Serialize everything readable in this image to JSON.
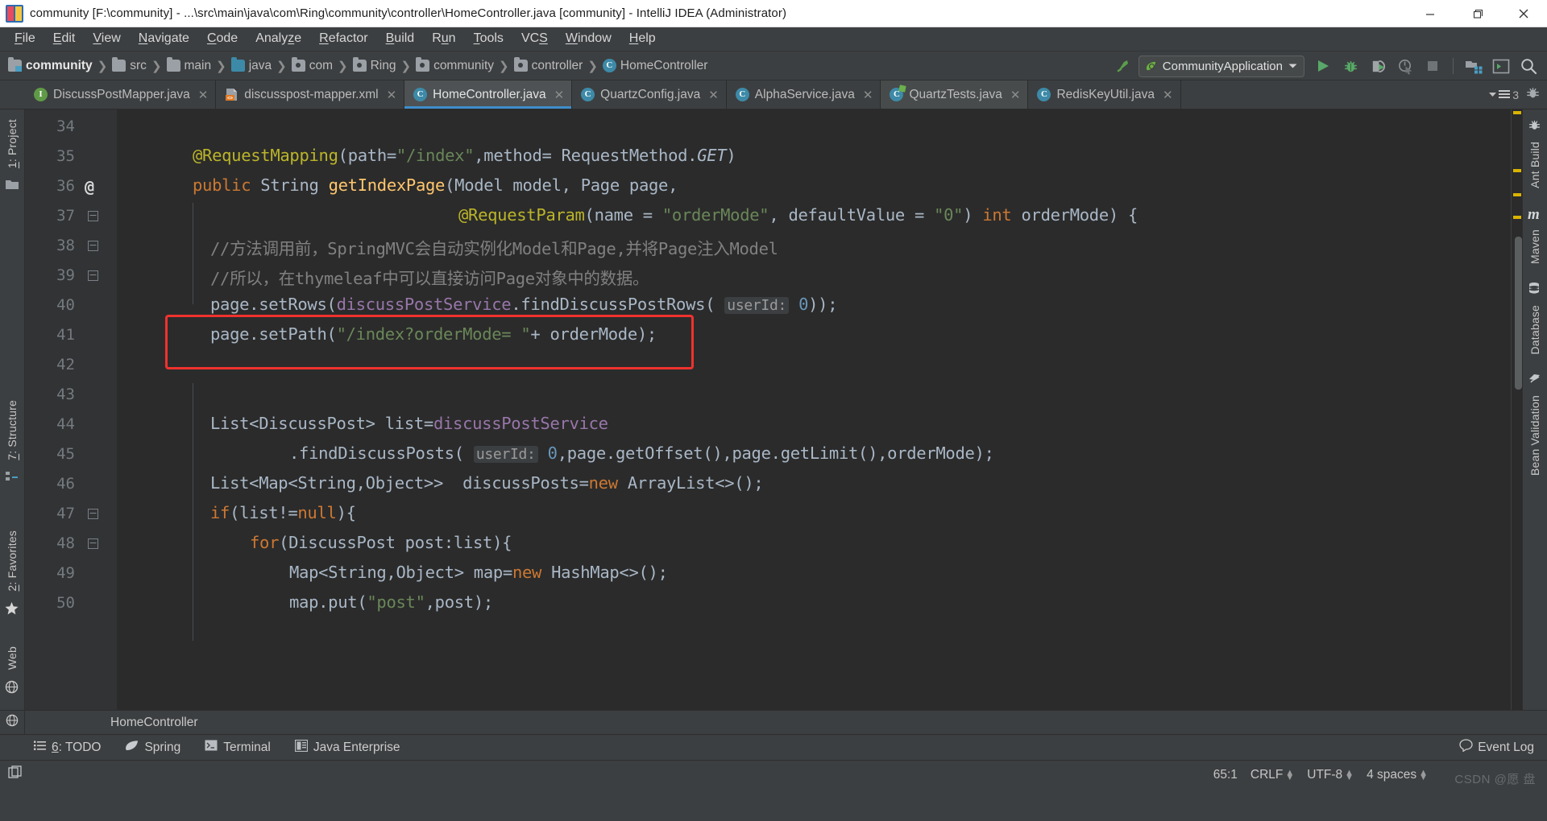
{
  "window": {
    "title": "community [F:\\community] - ...\\src\\main\\java\\com\\Ring\\community\\controller\\HomeController.java [community] - IntelliJ IDEA (Administrator)",
    "app_icon": "intellij-idea-icon",
    "minimize_label": "Minimize",
    "maximize_label": "Restore",
    "close_label": "Close"
  },
  "menubar": {
    "items": [
      {
        "label": "File",
        "mnemonic": "F"
      },
      {
        "label": "Edit",
        "mnemonic": "E"
      },
      {
        "label": "View",
        "mnemonic": "V"
      },
      {
        "label": "Navigate",
        "mnemonic": "N"
      },
      {
        "label": "Code",
        "mnemonic": "C"
      },
      {
        "label": "Analyze",
        "mnemonic": "z"
      },
      {
        "label": "Refactor",
        "mnemonic": "R"
      },
      {
        "label": "Build",
        "mnemonic": "B"
      },
      {
        "label": "Run",
        "mnemonic": "n"
      },
      {
        "label": "Tools",
        "mnemonic": "T"
      },
      {
        "label": "VCS",
        "mnemonic": "S"
      },
      {
        "label": "Window",
        "mnemonic": "W"
      },
      {
        "label": "Help",
        "mnemonic": "H"
      }
    ]
  },
  "breadcrumb": {
    "items": [
      {
        "label": "community",
        "icon": "project-folder-icon"
      },
      {
        "label": "src",
        "icon": "source-folder-icon"
      },
      {
        "label": "main",
        "icon": "folder-icon"
      },
      {
        "label": "java",
        "icon": "java-source-folder-icon"
      },
      {
        "label": "com",
        "icon": "package-icon"
      },
      {
        "label": "Ring",
        "icon": "package-icon"
      },
      {
        "label": "community",
        "icon": "package-icon"
      },
      {
        "label": "controller",
        "icon": "package-icon"
      },
      {
        "label": "HomeController",
        "icon": "java-class-icon"
      }
    ]
  },
  "toolbar": {
    "build_label": "Build Project",
    "run_config": "CommunityApplication",
    "run_config_icon": "spring-boot-icon",
    "buttons": [
      {
        "name": "run-button",
        "icon": "play-icon",
        "label": "Run"
      },
      {
        "name": "debug-button",
        "icon": "bug-icon",
        "label": "Debug"
      },
      {
        "name": "run-with-coverage-button",
        "icon": "coverage-icon",
        "label": "Run with Coverage"
      },
      {
        "name": "profile-button",
        "icon": "profiler-icon",
        "label": "Profile"
      },
      {
        "name": "stop-button",
        "icon": "stop-icon",
        "label": "Stop"
      },
      {
        "name": "project-structure-button",
        "icon": "project-structure-icon",
        "label": "Project Structure"
      },
      {
        "name": "terminal-button",
        "icon": "terminal-window-icon",
        "label": "Terminal"
      },
      {
        "name": "search-everywhere-button",
        "icon": "search-icon",
        "label": "Search Everywhere"
      }
    ]
  },
  "editor_tabs": {
    "tabs": [
      {
        "label": "DiscussPostMapper.java",
        "icon": "interface-icon",
        "active": false
      },
      {
        "label": "discusspost-mapper.xml",
        "icon": "xml-file-icon",
        "active": false
      },
      {
        "label": "HomeController.java",
        "icon": "class-icon",
        "active": true
      },
      {
        "label": "QuartzConfig.java",
        "icon": "class-icon",
        "active": false
      },
      {
        "label": "AlphaService.java",
        "icon": "class-icon",
        "active": false
      },
      {
        "label": "QuartzTests.java",
        "icon": "test-class-icon",
        "active": false
      },
      {
        "label": "RedisKeyUtil.java",
        "icon": "class-icon",
        "active": false
      }
    ],
    "tab_count": "3",
    "tab_list_icon": "tab-list-icon",
    "ant_icon": "ant-build-icon"
  },
  "left_tool_strip": {
    "items": [
      {
        "label": "1: Project",
        "mnemonic": "1",
        "icon": "project-tool-icon"
      },
      {
        "label": "7: Structure",
        "mnemonic": "7",
        "icon": "structure-tool-icon"
      },
      {
        "label": "2: Favorites",
        "mnemonic": "2",
        "icon": "favorites-star-icon"
      },
      {
        "label": "Web",
        "mnemonic": "",
        "icon": "web-globe-icon"
      }
    ]
  },
  "right_tool_strip": {
    "items": [
      {
        "label": "Ant Build",
        "icon": "ant-icon"
      },
      {
        "label": "Maven",
        "icon": "maven-m-icon"
      },
      {
        "label": "Database",
        "icon": "database-cylinder-icon"
      },
      {
        "label": "Bean Validation",
        "icon": "bean-validation-icon"
      }
    ]
  },
  "editor": {
    "first_line": 34,
    "annotation_box": {
      "color": "#f0322e",
      "target_line": 41,
      "note": "highlighted code line"
    },
    "lines": [
      {
        "num": 34,
        "indent": 0,
        "tokens": []
      },
      {
        "num": 35,
        "indent": 0,
        "tokens": [
          {
            "t": "@RequestMapping",
            "c": "t-ann"
          },
          {
            "t": "(",
            "c": "t-def"
          },
          {
            "t": "path=",
            "c": "t-def"
          },
          {
            "t": "\"/index\"",
            "c": "t-str"
          },
          {
            "t": ",",
            "c": "t-def"
          },
          {
            "t": "method= RequestMethod.",
            "c": "t-def"
          },
          {
            "t": "GET",
            "c": "t-stc"
          },
          {
            "t": ")",
            "c": "t-def"
          }
        ]
      },
      {
        "num": 36,
        "indent": 0,
        "gutter_icon": "override-at-icon",
        "tokens": [
          {
            "t": "public ",
            "c": "t-kw"
          },
          {
            "t": "String ",
            "c": "t-def"
          },
          {
            "t": "getIndexPage",
            "c": "t-mth"
          },
          {
            "t": "(Model model, Page page,",
            "c": "t-def"
          }
        ]
      },
      {
        "num": 37,
        "indent": 1,
        "fold": true,
        "tokens": [
          {
            "t": "@RequestParam",
            "c": "t-ann"
          },
          {
            "t": "(name = ",
            "c": "t-def"
          },
          {
            "t": "\"orderMode\"",
            "c": "t-str"
          },
          {
            "t": ", defaultValue = ",
            "c": "t-def"
          },
          {
            "t": "\"0\"",
            "c": "t-str"
          },
          {
            "t": ") ",
            "c": "t-def"
          },
          {
            "t": "int ",
            "c": "t-kw"
          },
          {
            "t": "orderMode) {",
            "c": "t-def"
          }
        ]
      },
      {
        "num": 38,
        "indent": 1,
        "fold": true,
        "tokens": [
          {
            "t": "//方法调用前，SpringMVC会自动实例化Model和Page,并将Page注入Model",
            "c": "t-cmt"
          }
        ]
      },
      {
        "num": 39,
        "indent": 1,
        "fold": true,
        "tokens": [
          {
            "t": "//所以，在thymeleaf中可以直接访问Page对象中的数据。",
            "c": "t-cmt"
          }
        ]
      },
      {
        "num": 40,
        "indent": 1,
        "tokens": [
          {
            "t": "page",
            "c": "t-def"
          },
          {
            "t": ".",
            "c": "t-def"
          },
          {
            "t": "setRows",
            "c": "t-def"
          },
          {
            "t": "(",
            "c": "t-def"
          },
          {
            "t": "discussPostService",
            "c": "t-fld"
          },
          {
            "t": ".",
            "c": "t-def"
          },
          {
            "t": "findDiscussPostRows",
            "c": "t-def"
          },
          {
            "t": "( ",
            "c": "t-def"
          },
          {
            "t": "userId:",
            "c": "t-hint"
          },
          {
            "t": " ",
            "c": "t-def"
          },
          {
            "t": "0",
            "c": "t-num"
          },
          {
            "t": "));",
            "c": "t-def"
          }
        ]
      },
      {
        "num": 41,
        "indent": 1,
        "highlighted": true,
        "tokens": [
          {
            "t": "page",
            "c": "t-def"
          },
          {
            "t": ".",
            "c": "t-def"
          },
          {
            "t": "setPath",
            "c": "t-def"
          },
          {
            "t": "(",
            "c": "t-def"
          },
          {
            "t": "\"/index?orderMode= \"",
            "c": "t-str"
          },
          {
            "t": "+ orderMode);",
            "c": "t-def"
          }
        ]
      },
      {
        "num": 42,
        "indent": 1,
        "tokens": []
      },
      {
        "num": 43,
        "indent": 1,
        "tokens": []
      },
      {
        "num": 44,
        "indent": 1,
        "tokens": [
          {
            "t": "List<DiscussPost> list=",
            "c": "t-def"
          },
          {
            "t": "discussPostService",
            "c": "t-fld"
          }
        ]
      },
      {
        "num": 45,
        "indent": 2,
        "tokens": [
          {
            "t": ".",
            "c": "t-def"
          },
          {
            "t": "findDiscussPosts",
            "c": "t-def"
          },
          {
            "t": "( ",
            "c": "t-def"
          },
          {
            "t": "userId:",
            "c": "t-hint"
          },
          {
            "t": " ",
            "c": "t-def"
          },
          {
            "t": "0",
            "c": "t-num"
          },
          {
            "t": ",page.",
            "c": "t-def"
          },
          {
            "t": "getOffset",
            "c": "t-def"
          },
          {
            "t": "(),page.",
            "c": "t-def"
          },
          {
            "t": "getLimit",
            "c": "t-def"
          },
          {
            "t": "(),orderMode);",
            "c": "t-def"
          }
        ]
      },
      {
        "num": 46,
        "indent": 1,
        "tokens": [
          {
            "t": "List<Map<String,Object>>  discussPosts=",
            "c": "t-def"
          },
          {
            "t": "new ",
            "c": "t-kw"
          },
          {
            "t": "ArrayList<>();",
            "c": "t-def"
          }
        ]
      },
      {
        "num": 47,
        "indent": 1,
        "fold": true,
        "tokens": [
          {
            "t": "if",
            "c": "t-kw"
          },
          {
            "t": "(list!=",
            "c": "t-def"
          },
          {
            "t": "null",
            "c": "t-kw"
          },
          {
            "t": "){",
            "c": "t-def"
          }
        ]
      },
      {
        "num": 48,
        "indent": 2,
        "fold": true,
        "tokens": [
          {
            "t": "for",
            "c": "t-kw"
          },
          {
            "t": "(DiscussPost post:list){",
            "c": "t-def"
          }
        ]
      },
      {
        "num": 49,
        "indent": 3,
        "tokens": [
          {
            "t": "Map<String,Object> map=",
            "c": "t-def"
          },
          {
            "t": "new ",
            "c": "t-kw"
          },
          {
            "t": "HashMap<>();",
            "c": "t-def"
          }
        ]
      },
      {
        "num": 50,
        "indent": 3,
        "tokens": [
          {
            "t": "map.",
            "c": "t-def"
          },
          {
            "t": "put",
            "c": "t-def"
          },
          {
            "t": "(",
            "c": "t-def"
          },
          {
            "t": "\"post\"",
            "c": "t-str"
          },
          {
            "t": ",post);",
            "c": "t-def"
          }
        ]
      }
    ]
  },
  "editor_breadcrumb": {
    "label": "HomeController",
    "icon": "class-icon"
  },
  "tool_window_bar": {
    "items": [
      {
        "label": "6: TODO",
        "mnemonic": "6",
        "icon": "todo-list-icon"
      },
      {
        "label": "Spring",
        "mnemonic": "",
        "icon": "spring-leaf-icon"
      },
      {
        "label": "Terminal",
        "mnemonic": "",
        "icon": "terminal-icon"
      },
      {
        "label": "Java Enterprise",
        "mnemonic": "",
        "icon": "java-enterprise-icon"
      }
    ],
    "event_log": "Event Log",
    "event_log_icon": "event-log-icon"
  },
  "statusbar": {
    "hide_icon": "hide-tool-windows-icon",
    "caret_position": "65:1",
    "line_separator": "CRLF",
    "encoding": "UTF-8",
    "indent": "4 spaces",
    "watermark": "CSDN @愿 盘"
  },
  "colors": {
    "chrome": "#3c3f41",
    "editor_bg": "#2b2b2b",
    "gutter_bg": "#313335",
    "accent_blue": "#3e8ecb",
    "annotation_red": "#f0322e",
    "run_green": "#5a9e4b",
    "string_green": "#6a8759",
    "keyword_orange": "#cc7832",
    "annotation_yellow": "#bbb529",
    "field_purple": "#9876aa",
    "method_gold": "#ffc66d",
    "default_text": "#a9b7c6",
    "comment_gray": "#808080"
  }
}
